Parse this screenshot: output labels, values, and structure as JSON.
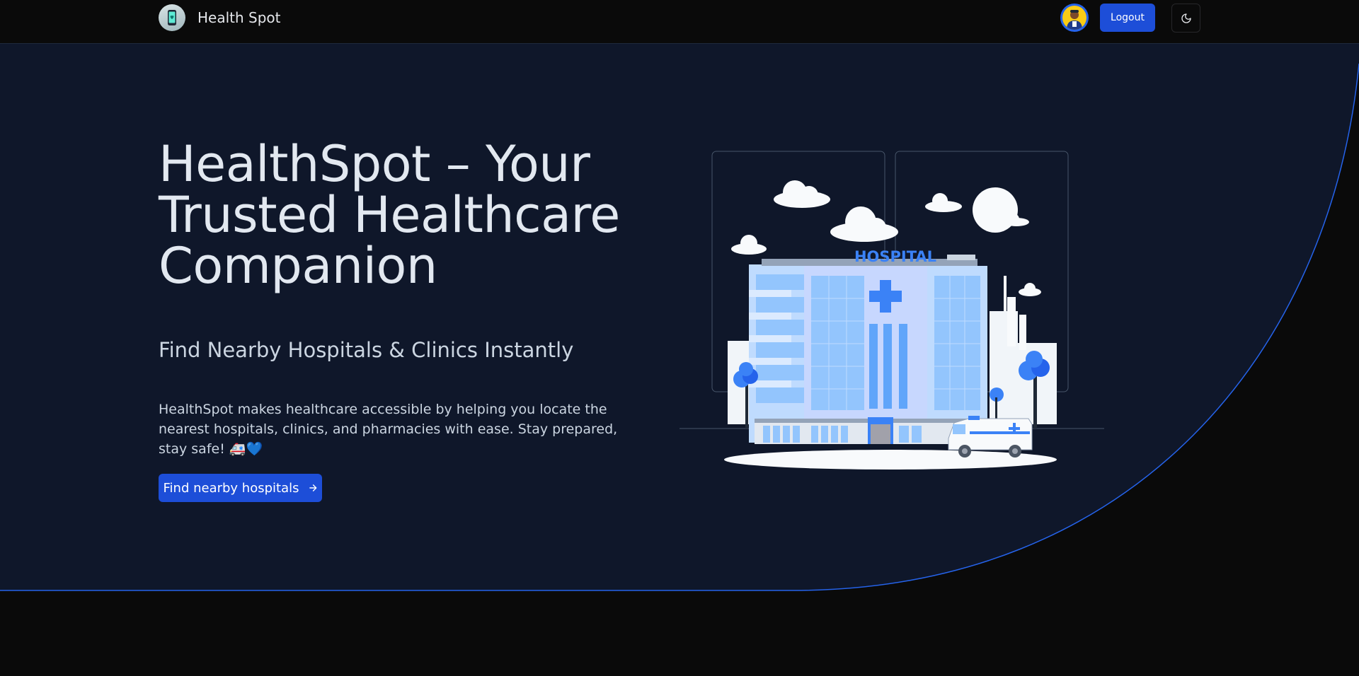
{
  "header": {
    "brand_name": "Health Spot",
    "logout_label": "Logout"
  },
  "hero": {
    "title": "HealthSpot – Your Trusted Healthcare Companion",
    "subtitle": "Find Nearby Hospitals & Clinics Instantly",
    "description": "HealthSpot makes healthcare accessible by helping you locate the nearest hospitals, clinics, and pharmacies with ease. Stay prepared, stay safe! 🚑💙",
    "cta_label": "Find nearby hospitals",
    "illustration_sign": "HOSPITAL"
  },
  "icons": {
    "brand": "phone-health-icon",
    "theme_toggle": "moon-icon",
    "cta": "arrow-right-icon"
  },
  "colors": {
    "page_background": "#0a0a0a",
    "hero_background": "#0f172a",
    "accent": "#1d4ed8",
    "curve_line": "#2563eb",
    "text_primary": "#e2e8f0"
  }
}
